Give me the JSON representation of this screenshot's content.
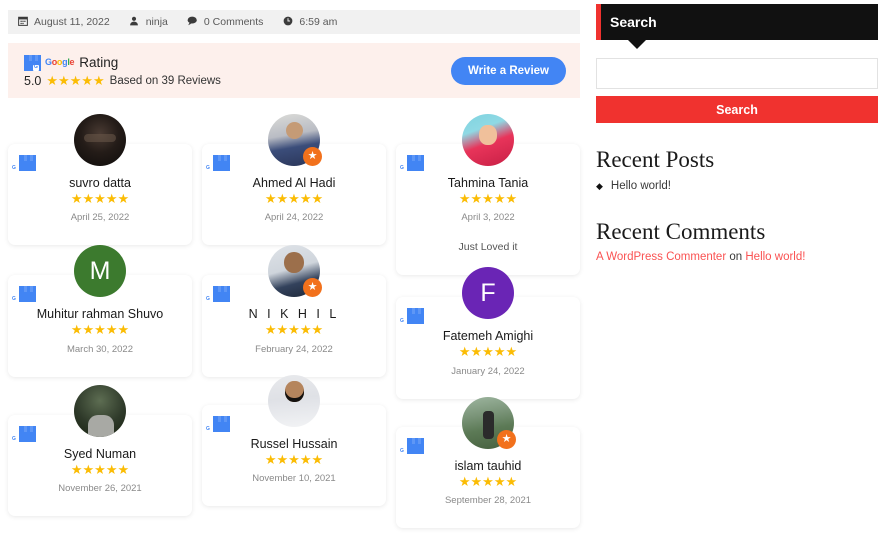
{
  "meta": {
    "items": [
      {
        "icon": "calendar-icon",
        "glyph": "Ὄ5",
        "label": "August 11, 2022"
      },
      {
        "icon": "user-icon",
        "glyph": "●",
        "label": "ninja"
      },
      {
        "icon": "comment-icon",
        "glyph": "●",
        "label": "0 Comments"
      },
      {
        "icon": "clock-icon",
        "glyph": "●",
        "label": "6:59 am"
      }
    ]
  },
  "rating_banner": {
    "provider": "Google",
    "rating_word": "Rating",
    "score": "5.0",
    "stars": "★★★★★",
    "based_on": "Based on 39 Reviews",
    "write_review_label": "Write a Review",
    "button_color": "#4285f4",
    "background_color": "#fdf0ec",
    "star_color": "#fbbc04"
  },
  "reviews": {
    "columns": [
      [
        {
          "name": "suvro datta",
          "stars": "★★★★★",
          "date": "April 25, 2022",
          "text": "",
          "avatar_kind": "photo",
          "avatar_class": "ph-suvro",
          "avatar_letter": "",
          "local_guide": false
        },
        {
          "name": "Muhitur rahman Shuvo",
          "stars": "★★★★★",
          "date": "March 30, 2022",
          "text": "",
          "avatar_kind": "letter",
          "avatar_class": "ph-m",
          "avatar_letter": "M",
          "local_guide": false
        },
        {
          "name": "Syed Numan",
          "stars": "★★★★★",
          "date": "November 26, 2021",
          "text": "",
          "avatar_kind": "photo",
          "avatar_class": "ph-syed",
          "avatar_letter": "",
          "local_guide": false
        }
      ],
      [
        {
          "name": "Ahmed Al Hadi",
          "stars": "★★★★★",
          "date": "April 24, 2022",
          "text": "",
          "avatar_kind": "photo",
          "avatar_class": "ph-ahmed",
          "avatar_letter": "",
          "local_guide": true
        },
        {
          "name": "N I K H I L",
          "stars": "★★★★★",
          "date": "February 24, 2022",
          "text": "",
          "avatar_kind": "photo",
          "avatar_class": "ph-nikhil",
          "avatar_letter": "",
          "local_guide": true
        },
        {
          "name": "Russel Hussain",
          "stars": "★★★★★",
          "date": "November 10, 2021",
          "text": "",
          "avatar_kind": "photo",
          "avatar_class": "ph-russel",
          "avatar_letter": "",
          "local_guide": false
        }
      ],
      [
        {
          "name": "Tahmina Tania",
          "stars": "★★★★★",
          "date": "April 3, 2022",
          "text": "Just Loved it",
          "avatar_kind": "photo",
          "avatar_class": "ph-tahmina",
          "avatar_letter": "",
          "local_guide": false
        },
        {
          "name": "Fatemeh Amighi",
          "stars": "★★★★★",
          "date": "January 24, 2022",
          "text": "",
          "avatar_kind": "letter",
          "avatar_class": "ph-f",
          "avatar_letter": "F",
          "local_guide": false
        },
        {
          "name": "islam tauhid",
          "stars": "★★★★★",
          "date": "September 28, 2021",
          "text": "",
          "avatar_kind": "photo",
          "avatar_class": "ph-islam",
          "avatar_letter": "",
          "local_guide": true
        }
      ]
    ]
  },
  "sidebar": {
    "search": {
      "widget_title": "Search",
      "value": "",
      "placeholder": "",
      "button_label": "Search",
      "header_color": "#111111",
      "accent_color": "#f0322f"
    },
    "recent_posts": {
      "title": "Recent Posts",
      "items": [
        {
          "label": "Hello world!"
        }
      ]
    },
    "recent_comments": {
      "title": "Recent Comments",
      "author": "A WordPress Commenter",
      "connector": "on",
      "post": "Hello world!",
      "link_color": "#fa5252"
    }
  }
}
